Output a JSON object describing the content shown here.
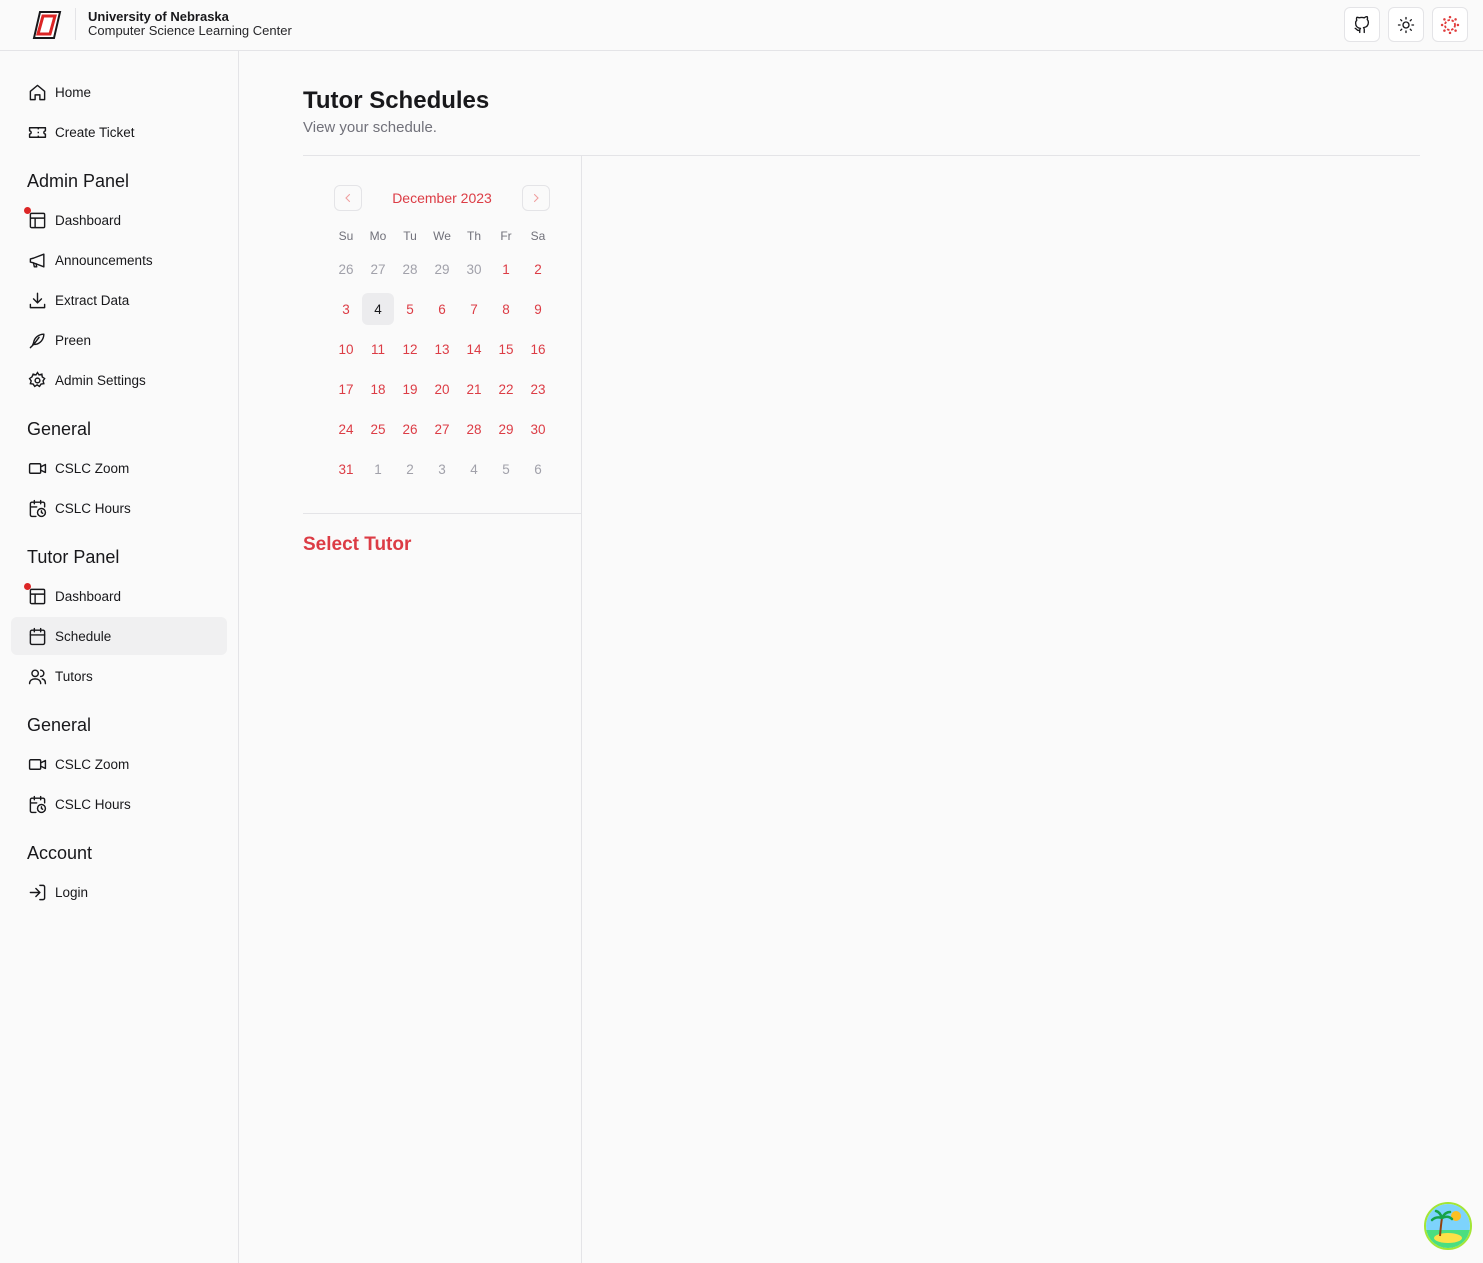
{
  "header": {
    "title": "University of Nebraska",
    "subtitle": "Computer Science Learning Center",
    "icons": [
      "github-icon",
      "sun-icon",
      "canvas-icon"
    ]
  },
  "sidebar": {
    "top_items": [
      {
        "label": "Home",
        "icon": "home-icon"
      },
      {
        "label": "Create Ticket",
        "icon": "ticket-icon"
      }
    ],
    "sections": [
      {
        "title": "Admin Panel",
        "items": [
          {
            "label": "Dashboard",
            "icon": "dashboard-icon",
            "notify": true
          },
          {
            "label": "Announcements",
            "icon": "megaphone-icon"
          },
          {
            "label": "Extract Data",
            "icon": "download-icon"
          },
          {
            "label": "Preen",
            "icon": "feather-icon"
          },
          {
            "label": "Admin Settings",
            "icon": "gear-icon"
          }
        ]
      },
      {
        "title": "General",
        "items": [
          {
            "label": "CSLC Zoom",
            "icon": "video-icon"
          },
          {
            "label": "CSLC Hours",
            "icon": "calendar-clock-icon"
          }
        ]
      },
      {
        "title": "Tutor Panel",
        "items": [
          {
            "label": "Dashboard",
            "icon": "dashboard-icon",
            "notify": true
          },
          {
            "label": "Schedule",
            "icon": "calendar-icon",
            "active": true
          },
          {
            "label": "Tutors",
            "icon": "users-icon"
          }
        ]
      },
      {
        "title": "General",
        "items": [
          {
            "label": "CSLC Zoom",
            "icon": "video-icon"
          },
          {
            "label": "CSLC Hours",
            "icon": "calendar-clock-icon"
          }
        ]
      },
      {
        "title": "Account",
        "items": [
          {
            "label": "Login",
            "icon": "login-icon"
          }
        ]
      }
    ]
  },
  "main": {
    "title": "Tutor Schedules",
    "subtitle": "View your schedule.",
    "select_tutor": "Select Tutor"
  },
  "calendar": {
    "month": "December 2023",
    "weekdays": [
      "Su",
      "Mo",
      "Tu",
      "We",
      "Th",
      "Fr",
      "Sa"
    ],
    "weeks": [
      [
        "26",
        "27",
        "28",
        "29",
        "30",
        "1",
        "2"
      ],
      [
        "3",
        "4",
        "5",
        "6",
        "7",
        "8",
        "9"
      ],
      [
        "10",
        "11",
        "12",
        "13",
        "14",
        "15",
        "16"
      ],
      [
        "17",
        "18",
        "19",
        "20",
        "21",
        "22",
        "23"
      ],
      [
        "24",
        "25",
        "26",
        "27",
        "28",
        "29",
        "30"
      ],
      [
        "31",
        "1",
        "2",
        "3",
        "4",
        "5",
        "6"
      ]
    ],
    "today": "4"
  },
  "colors": {
    "accent": "#dc3c45",
    "border": "#e4e4e7",
    "muted": "#71717a",
    "notify": "#dc2626"
  }
}
